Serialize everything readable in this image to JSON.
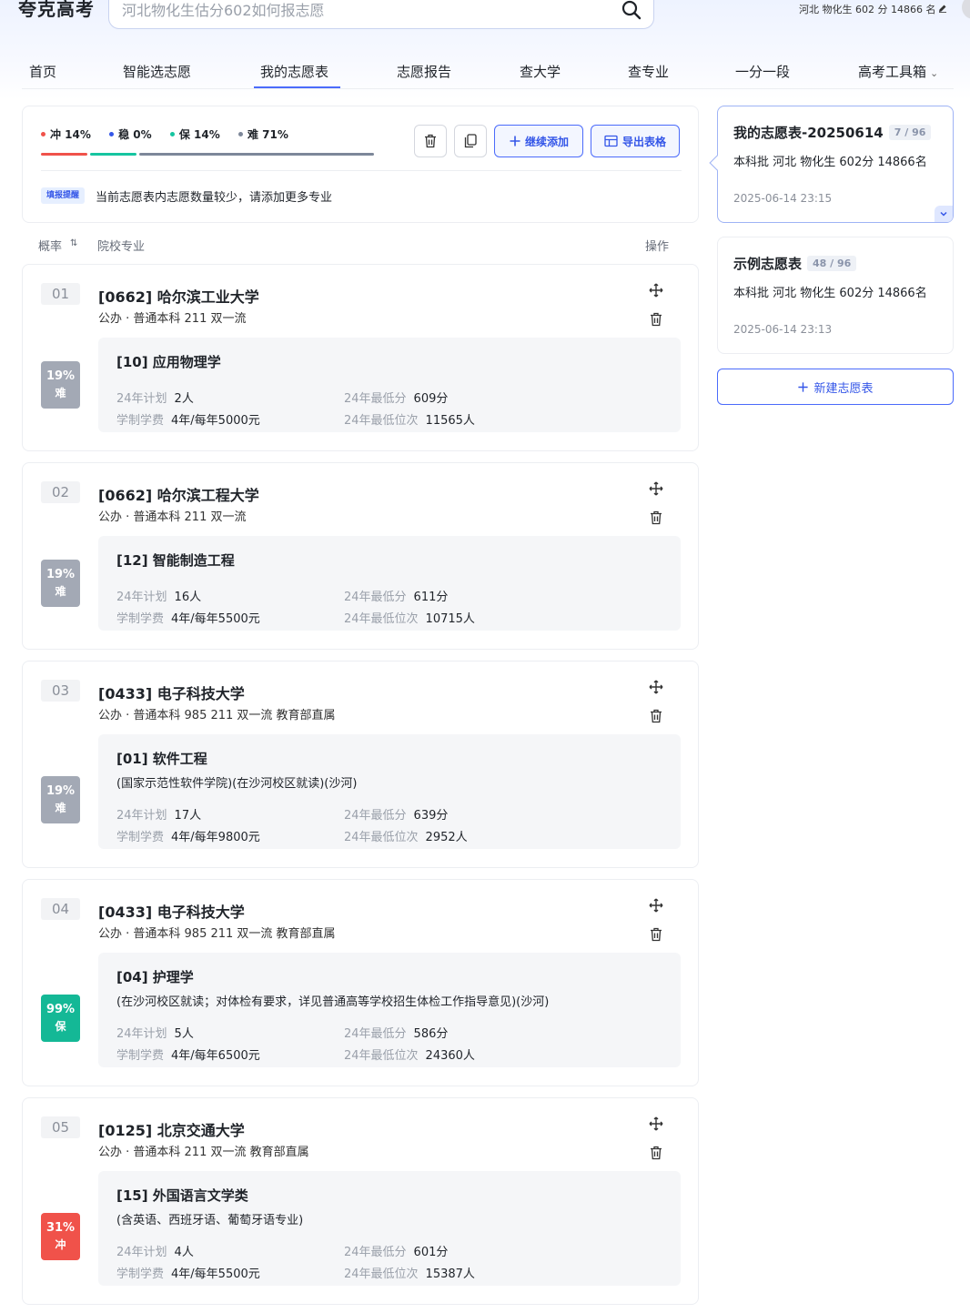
{
  "header": {
    "logo": "夸克高考",
    "search_placeholder": "河北物化生估分602如何报志愿",
    "user_info": "河北 物化生  602 分 14866 名"
  },
  "nav": {
    "items": [
      "首页",
      "智能选志愿",
      "我的志愿表",
      "志愿报告",
      "查大学",
      "查专业",
      "一分一段",
      "高考工具箱"
    ],
    "active": "我的志愿表"
  },
  "summary": {
    "legend": [
      {
        "label": "冲 14%",
        "color": "#f0524a"
      },
      {
        "label": "稳 0%",
        "color": "#3456e8"
      },
      {
        "label": "保 14%",
        "color": "#16c5a0"
      },
      {
        "label": "难 71%",
        "color": "#7d8799"
      }
    ],
    "bar": [
      {
        "fraction": 0.14,
        "color": "#f0524a"
      },
      {
        "fraction": 0.14,
        "color": "#16c5a0"
      },
      {
        "fraction": 0.71,
        "color": "#7d8799"
      }
    ],
    "continue_add": "继续添加",
    "export_table": "导出表格",
    "tip_badge": "填报提醒",
    "tip_text": "当前志愿表内志愿数量较少，请添加更多专业"
  },
  "table_header": {
    "probability": "概率",
    "school_major": "院校专业",
    "operation": "操作"
  },
  "entries": [
    {
      "index": "01",
      "school": "[0662] 哈尔滨工业大学",
      "tags": "公办 · 普通本科 211 双一流",
      "prob": "19%",
      "level": "难",
      "color": "#a3a9b5",
      "major": "[10] 应用物理学",
      "note": "",
      "plan_label": "24年计划",
      "plan": "2人",
      "fee_label": "学制学费",
      "fee": "4年/每年5000元",
      "minscore_label": "24年最低分",
      "minscore": "609分",
      "minrank_label": "24年最低位次",
      "minrank": "11565人"
    },
    {
      "index": "02",
      "school": "[0662] 哈尔滨工程大学",
      "tags": "公办 · 普通本科 211 双一流",
      "prob": "19%",
      "level": "难",
      "color": "#a3a9b5",
      "major": "[12] 智能制造工程",
      "note": "",
      "plan_label": "24年计划",
      "plan": "16人",
      "fee_label": "学制学费",
      "fee": "4年/每年5500元",
      "minscore_label": "24年最低分",
      "minscore": "611分",
      "minrank_label": "24年最低位次",
      "minrank": "10715人"
    },
    {
      "index": "03",
      "school": "[0433] 电子科技大学",
      "tags": "公办 · 普通本科 985 211 双一流 教育部直属",
      "prob": "19%",
      "level": "难",
      "color": "#a3a9b5",
      "major": "[01] 软件工程",
      "note": "(国家示范性软件学院)(在沙河校区就读)(沙河)",
      "plan_label": "24年计划",
      "plan": "17人",
      "fee_label": "学制学费",
      "fee": "4年/每年9800元",
      "minscore_label": "24年最低分",
      "minscore": "639分",
      "minrank_label": "24年最低位次",
      "minrank": "2952人"
    },
    {
      "index": "04",
      "school": "[0433] 电子科技大学",
      "tags": "公办 · 普通本科 985 211 双一流 教育部直属",
      "prob": "99%",
      "level": "保",
      "color": "#14b896",
      "major": "[04] 护理学",
      "note": "(在沙河校区就读；对体检有要求，详见普通高等学校招生体检工作指导意见)(沙河)",
      "plan_label": "24年计划",
      "plan": "5人",
      "fee_label": "学制学费",
      "fee": "4年/每年6500元",
      "minscore_label": "24年最低分",
      "minscore": "586分",
      "minrank_label": "24年最低位次",
      "minrank": "24360人"
    },
    {
      "index": "05",
      "school": "[0125] 北京交通大学",
      "tags": "公办 · 普通本科 211 双一流 教育部直属",
      "prob": "31%",
      "level": "冲",
      "color": "#f0524a",
      "major": "[15] 外国语言文学类",
      "note": "(含英语、西班牙语、葡萄牙语专业)",
      "plan_label": "24年计划",
      "plan": "4人",
      "fee_label": "学制学费",
      "fee": "4年/每年5500元",
      "minscore_label": "24年最低分",
      "minscore": "601分",
      "minrank_label": "24年最低位次",
      "minrank": "15387人"
    }
  ],
  "sidebar": {
    "tables": [
      {
        "title": "我的志愿表-20250614",
        "count": "7 / 96",
        "desc": "本科批 河北 物化生 602分 14866名",
        "time": "2025-06-14 23:15"
      },
      {
        "title": "示例志愿表",
        "count": "48 / 96",
        "desc": "本科批 河北 物化生 602分 14866名",
        "time": "2025-06-14 23:13"
      }
    ],
    "new_table": "新建志愿表"
  }
}
